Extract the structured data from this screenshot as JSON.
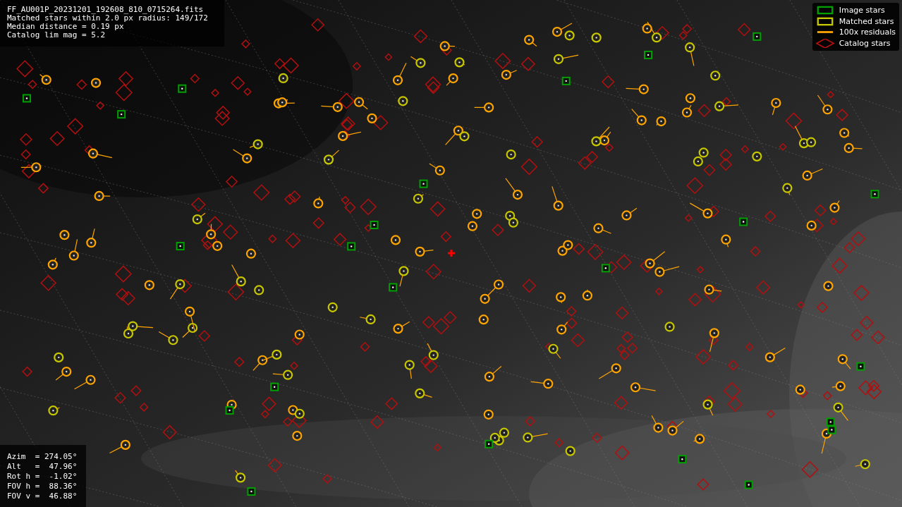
{
  "info_lines": [
    "FF_AU001P_20231201_192608_810_0715264.fits",
    "Matched stars within 2.0 px radius: 149/172",
    "Median distance = 0.19 px",
    "Catalog lim mag = 5.2"
  ],
  "legend": [
    {
      "label": "Image stars",
      "color": "#00a000"
    },
    {
      "kind": "matched",
      "label": "Matched stars",
      "color": "#c8c800"
    },
    {
      "kind": "residual",
      "label": "100x residuals",
      "color": "#ffa500"
    },
    {
      "kind": "catalog",
      "label": "Catalog stars",
      "color": "#b01010"
    }
  ],
  "pointing_lines": [
    "Azim  = 274.05°",
    "Alt   =  47.96°",
    "Rot h =  -1.02°",
    "FOV h =  88.36°",
    "FOV v =  46.88°"
  ]
}
